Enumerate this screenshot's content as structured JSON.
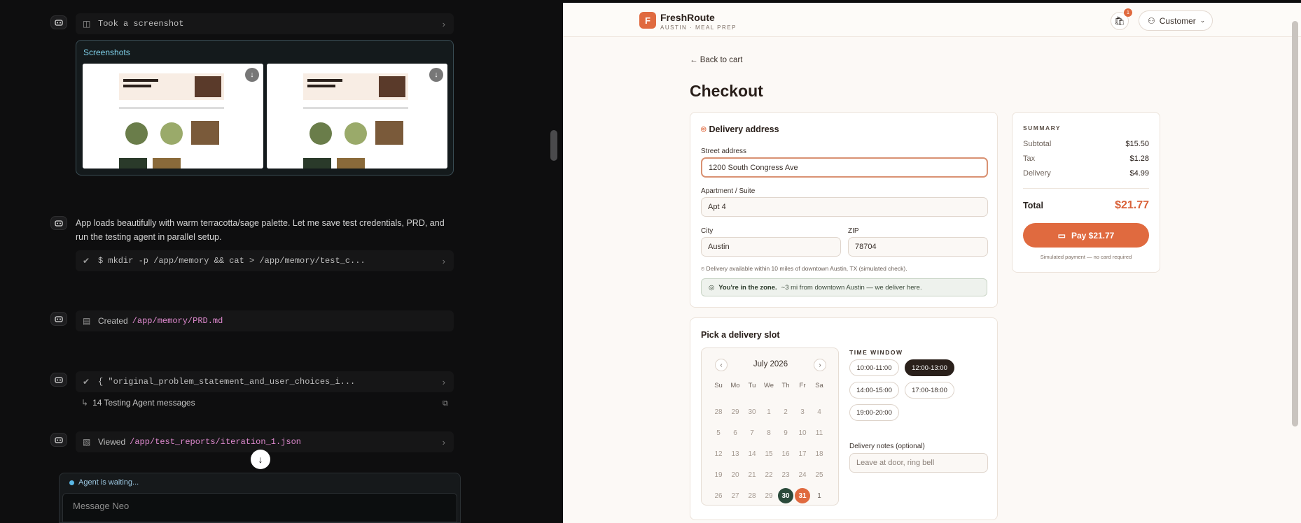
{
  "chat": {
    "screenshot_row": "Took a screenshot",
    "screenshots_title": "Screenshots",
    "message": "App loads beautifully with warm terracotta/sage palette. Let me save test credentials, PRD, and run the testing agent in parallel setup.",
    "cmd1": "$ mkdir -p /app/memory && cat > /app/memory/test_c...",
    "created_label": "Created",
    "created_path": "/app/memory/PRD.md",
    "cmd2": "{ \"original_problem_statement_and_user_choices_i...",
    "testing_msgs": "14 Testing Agent messages",
    "viewed_label": "Viewed",
    "viewed_path": "/app/test_reports/iteration_1.json",
    "waiting": "Agent is waiting...",
    "input_placeholder": "Message Neo"
  },
  "app": {
    "logo_letter": "F",
    "brand": "FreshRoute",
    "brand_sub": "AUSTIN · MEAL PREP",
    "cart_count": "1",
    "customer": "Customer",
    "back": "Back to cart",
    "title": "Checkout",
    "address": {
      "title": "Delivery address",
      "street_label": "Street address",
      "street_value": "1200 South Congress Ave",
      "apt_label": "Apartment / Suite",
      "apt_value": "Apt 4",
      "city_label": "City",
      "city_value": "Austin",
      "zip_label": "ZIP",
      "zip_value": "78704",
      "note": "Delivery available within 10 miles of downtown Austin, TX (simulated check).",
      "zone_bold": "You're in the zone.",
      "zone_text": "~3 mi from downtown Austin — we deliver here."
    },
    "slot": {
      "title": "Pick a delivery slot",
      "month": "July 2026",
      "weekdays": [
        "Su",
        "Mo",
        "Tu",
        "We",
        "Th",
        "Fr",
        "Sa"
      ],
      "days": [
        "28",
        "29",
        "30",
        "1",
        "2",
        "3",
        "4",
        "5",
        "6",
        "7",
        "8",
        "9",
        "10",
        "11",
        "12",
        "13",
        "14",
        "15",
        "16",
        "17",
        "18",
        "19",
        "20",
        "21",
        "22",
        "23",
        "24",
        "25",
        "26",
        "27",
        "28",
        "29",
        "30",
        "31",
        "1"
      ],
      "time_label": "TIME WINDOW",
      "times": [
        "10:00-11:00",
        "12:00-13:00",
        "14:00-15:00",
        "17:00-18:00",
        "19:00-20:00"
      ],
      "selected_time": "12:00-13:00",
      "notes_label": "Delivery notes (optional)",
      "notes_placeholder": "Leave at door, ring bell"
    },
    "summary": {
      "title": "SUMMARY",
      "subtotal_label": "Subtotal",
      "subtotal": "$15.50",
      "tax_label": "Tax",
      "tax": "$1.28",
      "delivery_label": "Delivery",
      "delivery": "$4.99",
      "total_label": "Total",
      "total": "$21.77",
      "pay": "Pay $21.77",
      "sim": "Simulated payment — no card required"
    }
  }
}
